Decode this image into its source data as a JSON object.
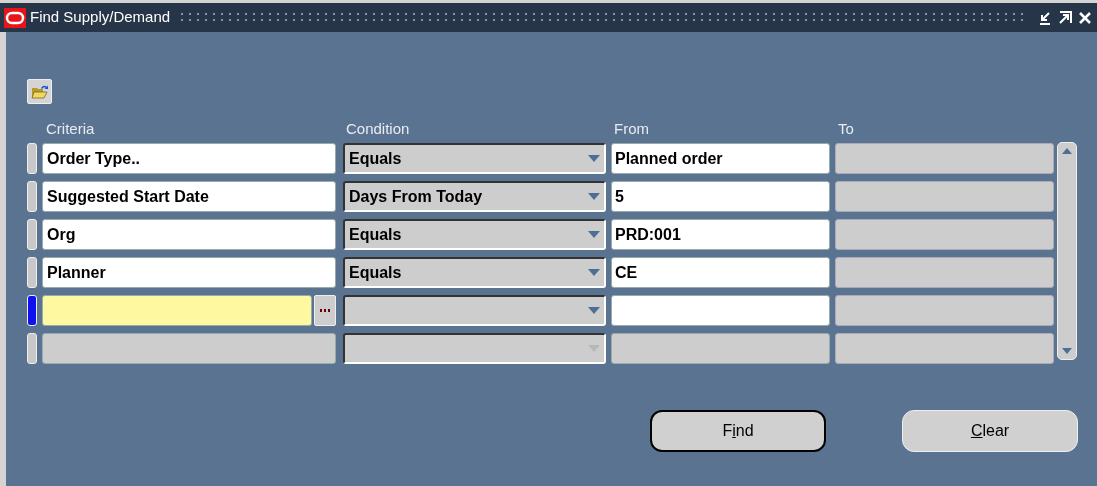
{
  "window": {
    "title": "Find Supply/Demand"
  },
  "columns": [
    "Criteria",
    "Condition",
    "From",
    "To"
  ],
  "rows": [
    {
      "criteria": "Order Type..",
      "condition": "Equals",
      "from": "Planned order",
      "current": false,
      "enabled": true
    },
    {
      "criteria": "Suggested Start Date",
      "condition": "Days From Today",
      "from": "5",
      "current": false,
      "enabled": true
    },
    {
      "criteria": "Org",
      "condition": "Equals",
      "from": "PRD:001",
      "current": false,
      "enabled": true
    },
    {
      "criteria": "Planner",
      "condition": "Equals",
      "from": "CE",
      "current": false,
      "enabled": true
    },
    {
      "current": true,
      "enabled": true
    },
    {
      "current": false,
      "enabled": false
    }
  ],
  "buttons": [
    {
      "label_parts": [
        {
          "text": "F",
          "underlined": false
        },
        {
          "text": "i",
          "underlined": true
        },
        {
          "text": "nd",
          "underlined": false
        }
      ],
      "default": true
    },
    {
      "label_parts": [
        {
          "text": "C",
          "underlined": true
        },
        {
          "text": "lear",
          "underlined": false
        }
      ],
      "default": false
    }
  ]
}
